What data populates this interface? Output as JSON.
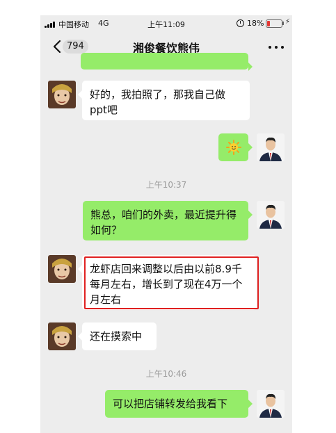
{
  "status_bar": {
    "carrier": "中国移动",
    "network": "4G",
    "time": "上午11:09",
    "battery_percent": "18%",
    "battery_level": 0.18,
    "charging_icon": "⚡",
    "battery_color": "#e53935"
  },
  "nav": {
    "back_icon": "chevron-left-icon",
    "unread_count": "794",
    "title": "湘俊餐饮熊伟",
    "more_icon": "more-dots-icon"
  },
  "colors": {
    "chat_background": "#ededed",
    "outgoing_bubble": "#95ec69",
    "incoming_bubble": "#ffffff",
    "highlight_box": "#e02020"
  },
  "messages": [
    {
      "direction": "outgoing",
      "text": ""
    },
    {
      "direction": "incoming",
      "text": "好的，我拍照了，那我自己做ppt吧"
    },
    {
      "direction": "outgoing",
      "text": "",
      "emoji_icon": "smiley-sun-emoji-icon"
    },
    {
      "type": "timestamp",
      "text": "上午10:37"
    },
    {
      "direction": "outgoing",
      "text": "熊总，咱们的外卖，最近提升得如何？"
    },
    {
      "direction": "incoming",
      "text": "龙虾店回来调整以后由以前8.9千每月左右，增长到了现在4万一个月左右",
      "highlighted": true
    },
    {
      "direction": "incoming",
      "text": "还在摸索中"
    },
    {
      "type": "timestamp",
      "text": "上午10:46"
    },
    {
      "direction": "outgoing",
      "text": "可以把店铺转发给我看下"
    }
  ]
}
